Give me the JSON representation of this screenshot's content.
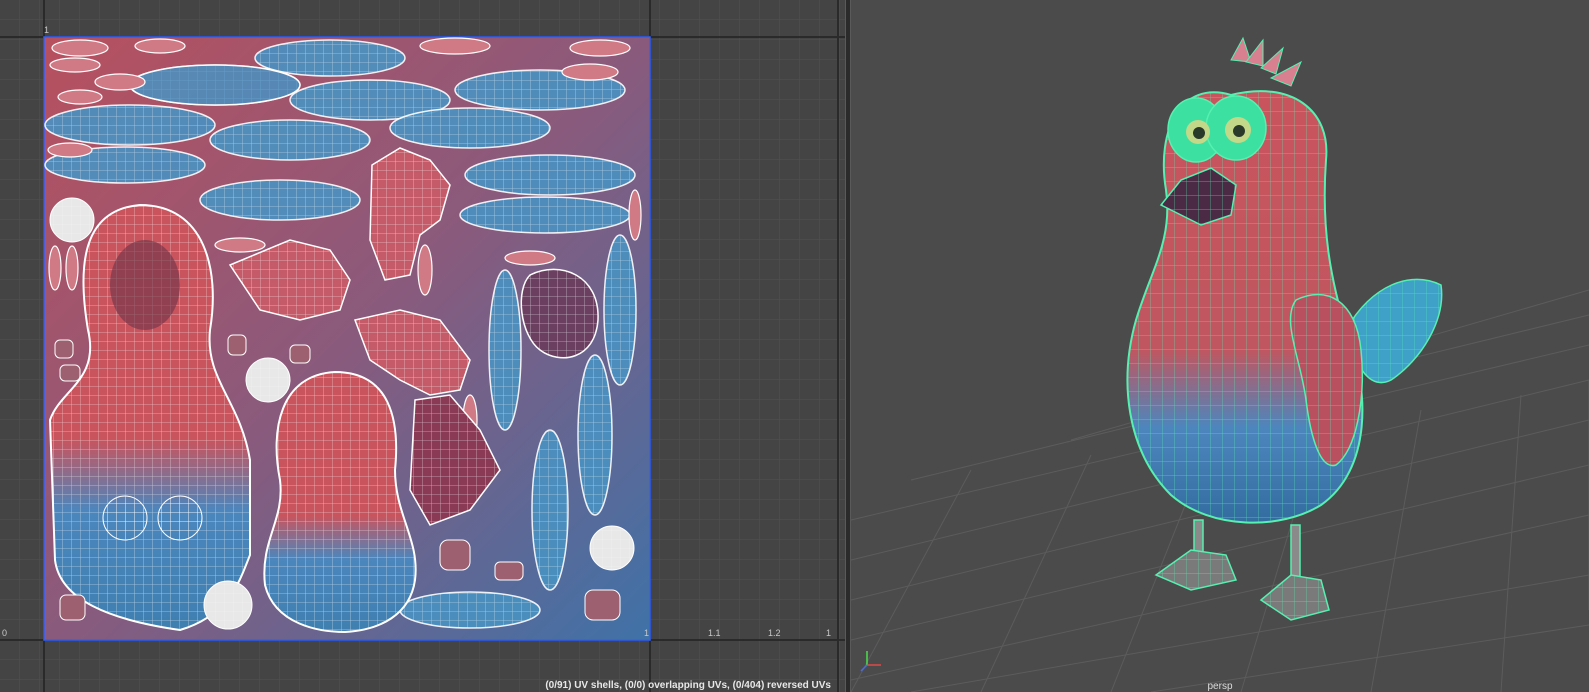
{
  "uv_editor": {
    "tick_labels": [
      "1",
      "0",
      "1",
      "1.1",
      "1.2",
      "1"
    ],
    "status": "(0/91) UV shells, (0/0) overlapping UVs, (0/404) reversed UVs"
  },
  "viewport": {
    "camera": "persp"
  },
  "colors": {
    "uv_bg": "#444444",
    "viewport_bg": "#4b4b4b",
    "body_red": "#c9545d",
    "body_blue": "#3f7fb0",
    "wire_uv": "#ffffff",
    "wire_selected": "#56f0b0"
  }
}
